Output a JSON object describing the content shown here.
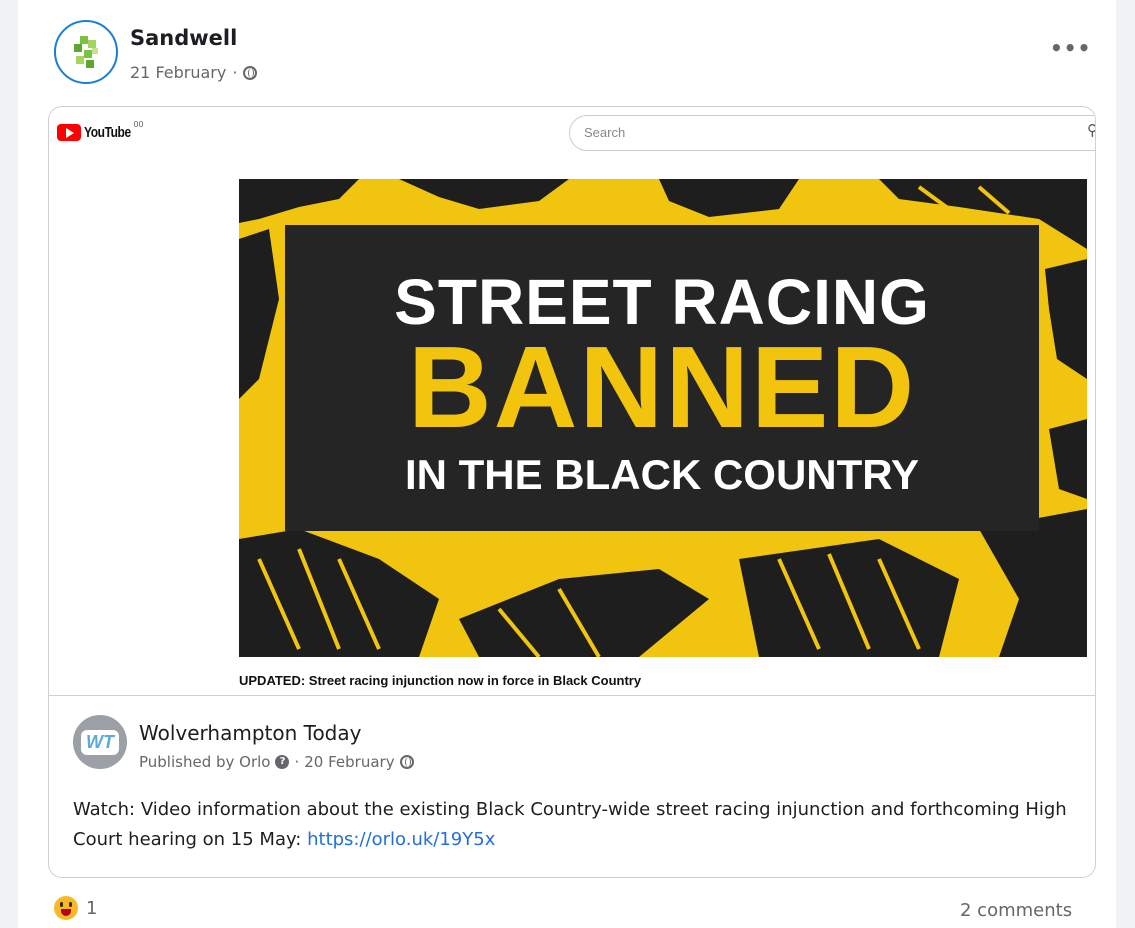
{
  "post": {
    "author": "Sandwell",
    "date": "21 February",
    "separator": "·",
    "more_label": "•••"
  },
  "embed": {
    "youtube_label": "YouTube",
    "youtube_sup": "00",
    "search_placeholder": "Search",
    "thumbnail": {
      "line1": "STREET RACING",
      "line2": "BANNED",
      "line3": "IN THE BLACK COUNTRY"
    },
    "caption": "UPDATED: Street racing injunction now in force in Black Country"
  },
  "shared_post": {
    "avatar_text": "WT",
    "author": "Wolverhampton Today",
    "published_by": "Published by Orlo",
    "separator": "·",
    "date": "20 February",
    "text": "Watch: Video information about the existing Black Country-wide street racing injunction and forthcoming High Court hearing on 15 May: ",
    "link": "https://orlo.uk/19Y5x"
  },
  "footer": {
    "reaction_count": "1",
    "comments": "2 comments"
  },
  "colors": {
    "brand_yellow": "#f2c40d",
    "link_blue": "#216fdb",
    "youtube_red": "#ff0000"
  }
}
